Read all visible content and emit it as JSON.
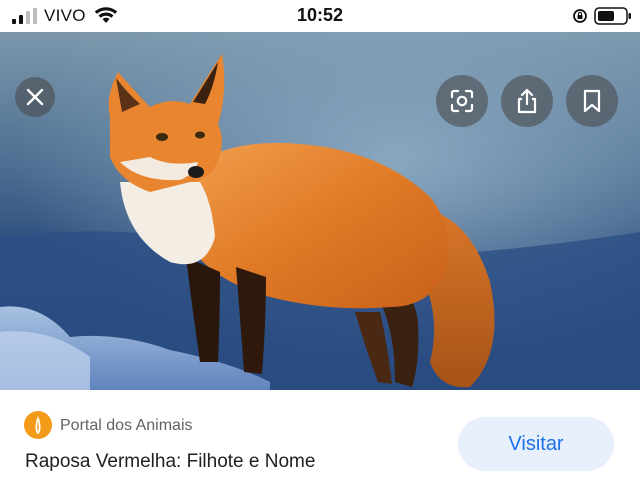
{
  "status_bar": {
    "carrier": "VIVO",
    "time": "10:52",
    "icons": [
      "signal-icon",
      "wifi-icon",
      "rotation-lock-icon",
      "battery-icon"
    ]
  },
  "image_viewer": {
    "image_subject": "red fox in snow",
    "controls": [
      "close-icon",
      "lens-icon",
      "share-icon",
      "bookmark-icon"
    ]
  },
  "result": {
    "source_name": "Portal dos Animais",
    "title": "Raposa Vermelha: Filhote e Nome",
    "visit_label": "Visitar"
  },
  "colors": {
    "visit_button_bg": "#e8f0fe",
    "visit_button_text": "#1a73e8",
    "source_icon": "#f39a18",
    "fox_fur": "#e27d2a"
  }
}
